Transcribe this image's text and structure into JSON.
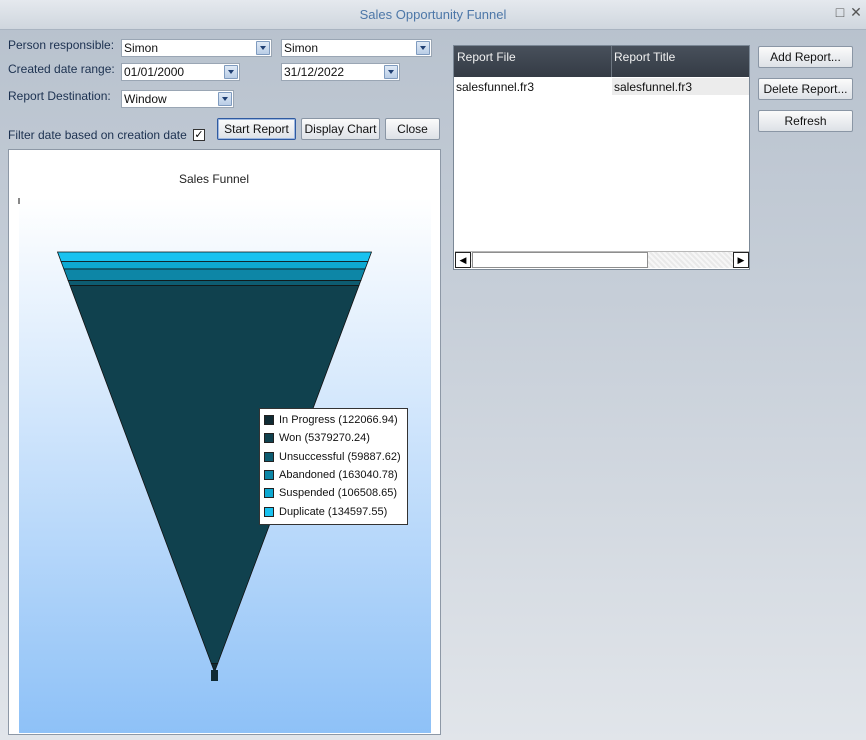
{
  "window": {
    "title": "Sales Opportunity Funnel"
  },
  "form": {
    "person_label": "Person responsible:",
    "person_from": "Simon",
    "person_to": "Simon",
    "date_label": "Created date range:",
    "date_from": "01/01/2000",
    "date_to": "31/12/2022",
    "destination_label": "Report Destination:",
    "destination": "Window",
    "filter_label": "Filter date based on creation date",
    "filter_checked": true,
    "filter_check_glyph": "✓"
  },
  "buttons": {
    "start": "Start Report",
    "display_chart": "Display Chart",
    "close": "Close",
    "add": "Add Report...",
    "delete": "Delete Report...",
    "refresh": "Refresh"
  },
  "reports": {
    "columns": [
      "Report File",
      "Report Title"
    ],
    "rows": [
      {
        "file": "salesfunnel.fr3",
        "title": "salesfunnel.fr3"
      }
    ]
  },
  "icons": {
    "minimize": "minimize-icon",
    "close": "close-icon",
    "scroll_left": "scroll-left-arrow-icon",
    "scroll_right": "scroll-right-arrow-icon",
    "dropdown": "chevron-down-icon",
    "check": "checkmark-icon"
  },
  "chart_data": {
    "type": "funnel",
    "title": "Sales Funnel",
    "legend_position": "right-center",
    "categories": [
      "In Progress",
      "Won",
      "Unsuccessful",
      "Abandoned",
      "Suspended",
      "Duplicate"
    ],
    "values": [
      122066.94,
      5379270.24,
      59887.62,
      163040.78,
      106508.65,
      134597.55
    ],
    "legend_labels": [
      "In Progress (122066.94)",
      "Won (5379270.24)",
      "Unsuccessful (59887.62)",
      "Abandoned (163040.78)",
      "Suspended (106508.65)",
      "Duplicate (134597.55)"
    ],
    "colors": [
      "#0f2a33",
      "#10414e",
      "#0d5b70",
      "#0d86a6",
      "#0ea9d2",
      "#19c2f0"
    ],
    "background_gradient": [
      "#ffffff",
      "#8ec1f7"
    ],
    "edge_color": "#111111"
  }
}
